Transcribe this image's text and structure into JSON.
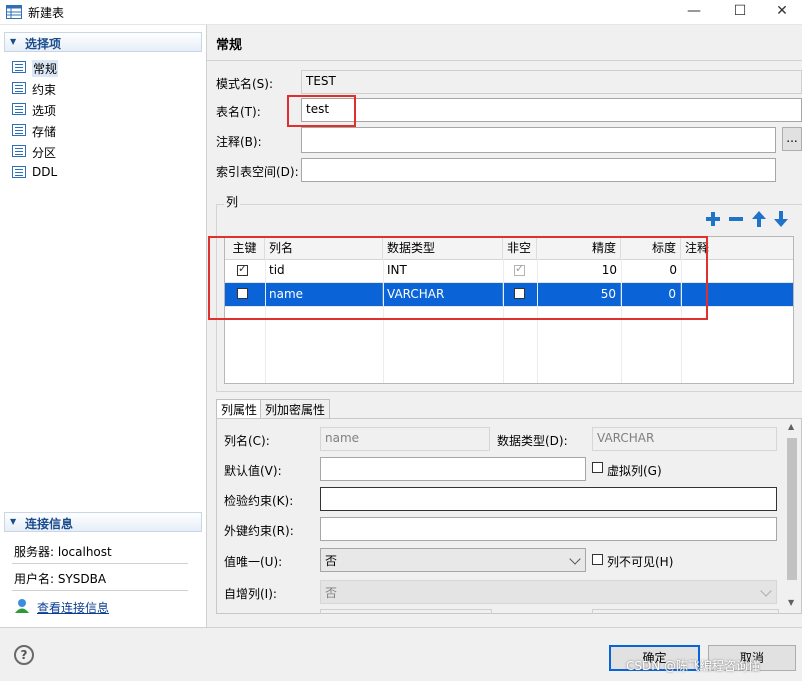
{
  "window": {
    "title": "新建表",
    "minimize": "—",
    "maximize": "☐",
    "close": "✕"
  },
  "sidebar": {
    "section_title": "选择项",
    "items": [
      {
        "label": "常规",
        "selected": true
      },
      {
        "label": "约束"
      },
      {
        "label": "选项"
      },
      {
        "label": "存储"
      },
      {
        "label": "分区"
      },
      {
        "label": "DDL"
      }
    ],
    "conn_title": "连接信息",
    "server": "服务器: localhost",
    "user": "用户名: SYSDBA",
    "view_link": "查看连接信息"
  },
  "main": {
    "heading": "常规",
    "schema_label": "模式名(S):",
    "schema_value": "TEST",
    "table_label": "表名(T):",
    "table_value": "test",
    "comment_label": "注释(B):",
    "comment_value": "",
    "more_button": "...",
    "tablespace_label": "索引表空间(D):",
    "tablespace_value": "",
    "columns_group": "列"
  },
  "grid": {
    "headers": [
      "主键",
      "列名",
      "数据类型",
      "非空",
      "精度",
      "标度",
      "注释"
    ],
    "rows": [
      {
        "pk": true,
        "name": "tid",
        "type": "INT",
        "notnull": true,
        "precision": "10",
        "scale": "0",
        "comment": ""
      },
      {
        "pk": false,
        "name": "name",
        "type": "VARCHAR",
        "notnull": false,
        "precision": "50",
        "scale": "0",
        "comment": "",
        "selected": true
      }
    ]
  },
  "props": {
    "tabs": [
      "列属性",
      "列加密属性"
    ],
    "colname_label": "列名(C):",
    "colname_value": "name",
    "datatype_label": "数据类型(D):",
    "datatype_value": "VARCHAR",
    "default_label": "默认值(V):",
    "default_value": "",
    "virtual_label": "虚拟列(G)",
    "check_label": "检验约束(K):",
    "check_value": "",
    "fk_label": "外键约束(R):",
    "fk_value": "",
    "unique_label": "值唯一(U):",
    "unique_value": "否",
    "invisible_label": "列不可见(H)",
    "identity_label": "自增列(I):",
    "identity_value": "否"
  },
  "footer": {
    "ok": "确定",
    "cancel": "取消",
    "help": "?",
    "watermark": "CSDN @陈飞编程咨询懂"
  },
  "colors": {
    "accent": "#0a64d8",
    "highlight": "#e0302e",
    "toolbar_icon": "#1f74c9"
  }
}
